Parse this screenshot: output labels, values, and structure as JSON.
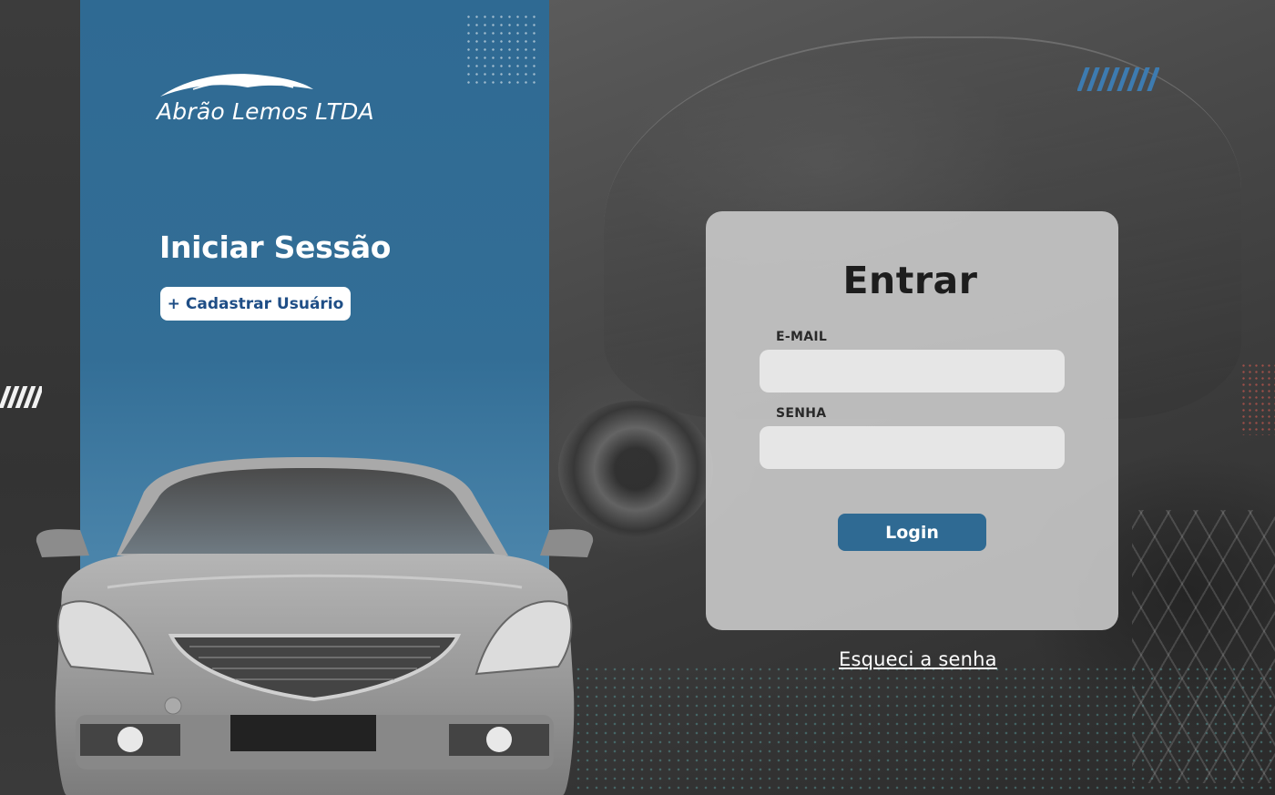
{
  "brand": {
    "name": "Abrão Lemos LTDA",
    "logo_icon": "car-swoosh-icon"
  },
  "panel": {
    "title": "Iniciar Sessão",
    "register_icon": "plus",
    "register_label": "Cadastrar Usuário"
  },
  "login_card": {
    "title": "Entrar",
    "email_label": "E-MAIL",
    "email_value": "",
    "email_placeholder": "",
    "password_label": "SENHA",
    "password_value": "",
    "password_placeholder": "",
    "submit_label": "Login"
  },
  "forgot_password_label": "Esqueci a senha",
  "colors": {
    "primary_blue": "#2f6a93",
    "card_background": "#cdcdcd",
    "input_background": "#e6e6e6",
    "register_text": "#1f4e86"
  }
}
